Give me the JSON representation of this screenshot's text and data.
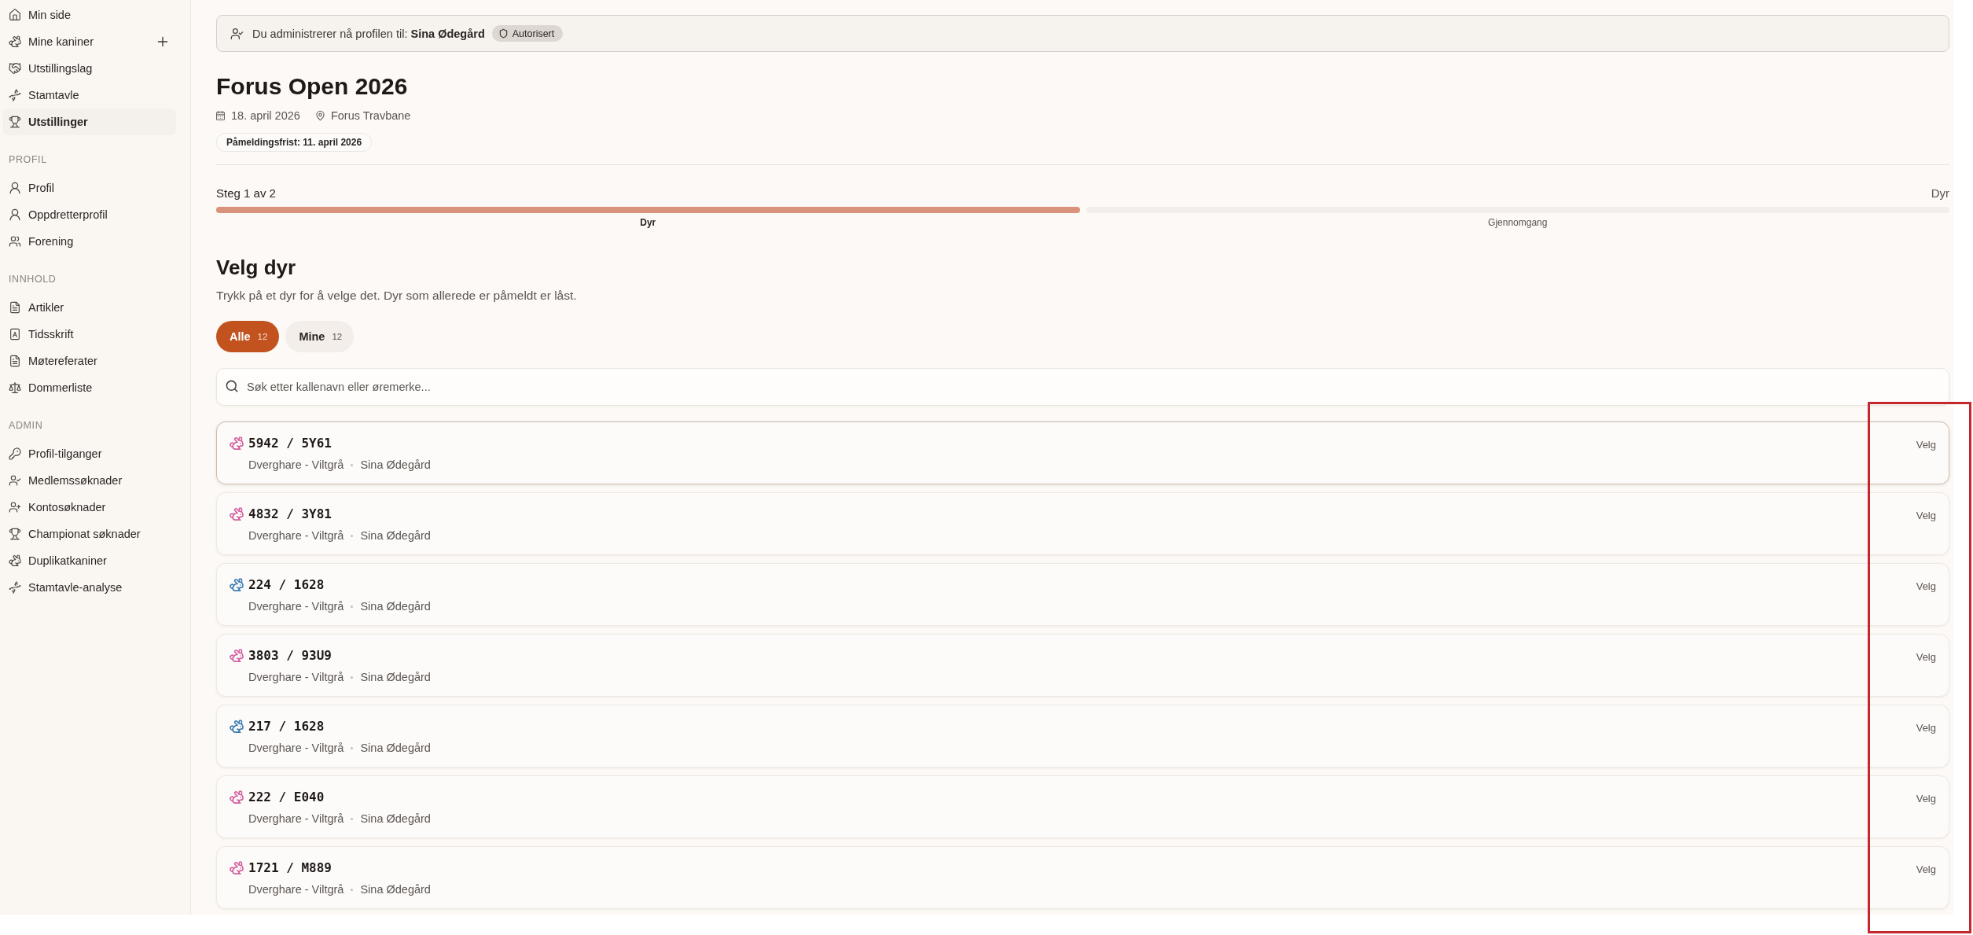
{
  "sidebar": {
    "sections": [
      {
        "items": [
          {
            "label": "Min side",
            "selected": false,
            "addable": false
          },
          {
            "label": "Mine kaniner",
            "selected": false,
            "addable": true
          },
          {
            "label": "Utstillingslag",
            "selected": false,
            "addable": false
          },
          {
            "label": "Stamtavle",
            "selected": false,
            "addable": false
          },
          {
            "label": "Utstillinger",
            "selected": true,
            "addable": false
          }
        ]
      },
      {
        "title": "PROFIL",
        "items": [
          {
            "label": "Profil",
            "selected": false
          },
          {
            "label": "Oppdretterprofil",
            "selected": false
          },
          {
            "label": "Forening",
            "selected": false
          }
        ]
      },
      {
        "title": "INNHOLD",
        "items": [
          {
            "label": "Artikler",
            "selected": false
          },
          {
            "label": "Tidsskrift",
            "selected": false
          },
          {
            "label": "Møtereferater",
            "selected": false
          },
          {
            "label": "Dommerliste",
            "selected": false
          }
        ]
      },
      {
        "title": "ADMIN",
        "items": [
          {
            "label": "Profil-tilganger",
            "selected": false
          },
          {
            "label": "Medlemssøknader",
            "selected": false
          },
          {
            "label": "Kontosøknader",
            "selected": false
          },
          {
            "label": "Championat søknader",
            "selected": false
          },
          {
            "label": "Duplikatkaniner",
            "selected": false
          },
          {
            "label": "Stamtavle-analyse",
            "selected": false
          }
        ]
      }
    ]
  },
  "banner": {
    "text": "Du administrerer nå profilen til: **Sina Ødegård**",
    "badge": "Autorisert"
  },
  "event": {
    "title": "Forus Open 2026",
    "date": "18. april 2026",
    "location": "Forus Travbane",
    "deadline": "Påmeldingsfrist: 11. april 2026"
  },
  "progress": {
    "counter": "Steg 1 av 2",
    "current_step": "Dyr",
    "steps": [
      {
        "label": "Dyr",
        "current": true
      },
      {
        "label": "Gjennomgang",
        "current": false
      }
    ]
  },
  "selection": {
    "title": "Velg dyr",
    "description": "Trykk på et dyr for å velge det. Dyr som allerede er påmeldt er låst.",
    "filters": [
      {
        "label": "Alle",
        "count": "12",
        "selected": true
      },
      {
        "label": "Mine",
        "count": "12",
        "selected": false
      }
    ],
    "search": {
      "placeholder": "Søk etter kallenavn eller øremerke..."
    },
    "animals": [
      {
        "id": "5942 / 5Y61",
        "breed": "Dverghare - Viltgrå",
        "owner": "Sina Ødegård",
        "action": "Velg",
        "color": "#d4619f",
        "focused": true
      },
      {
        "id": "4832 / 3Y81",
        "breed": "Dverghare - Viltgrå",
        "owner": "Sina Ødegård",
        "action": "Velg",
        "color": "#d4619f",
        "focused": false
      },
      {
        "id": "224 / 1628",
        "breed": "Dverghare - Viltgrå",
        "owner": "Sina Ødegård",
        "action": "Velg",
        "color": "#3f7fb3",
        "focused": false
      },
      {
        "id": "3803 / 93U9",
        "breed": "Dverghare - Viltgrå",
        "owner": "Sina Ødegård",
        "action": "Velg",
        "color": "#d4619f",
        "focused": false
      },
      {
        "id": "217 / 1628",
        "breed": "Dverghare - Viltgrå",
        "owner": "Sina Ødegård",
        "action": "Velg",
        "color": "#3f7fb3",
        "focused": false
      },
      {
        "id": "222 / E040",
        "breed": "Dverghare - Viltgrå",
        "owner": "Sina Ødegård",
        "action": "Velg",
        "color": "#d4619f",
        "focused": false
      },
      {
        "id": "1721 / M889",
        "breed": "Dverghare - Viltgrå",
        "owner": "Sina Ødegård",
        "action": "Velg",
        "color": "#d4619f",
        "focused": false
      }
    ]
  },
  "annotations": [
    {
      "kind": "frame"
    }
  ]
}
